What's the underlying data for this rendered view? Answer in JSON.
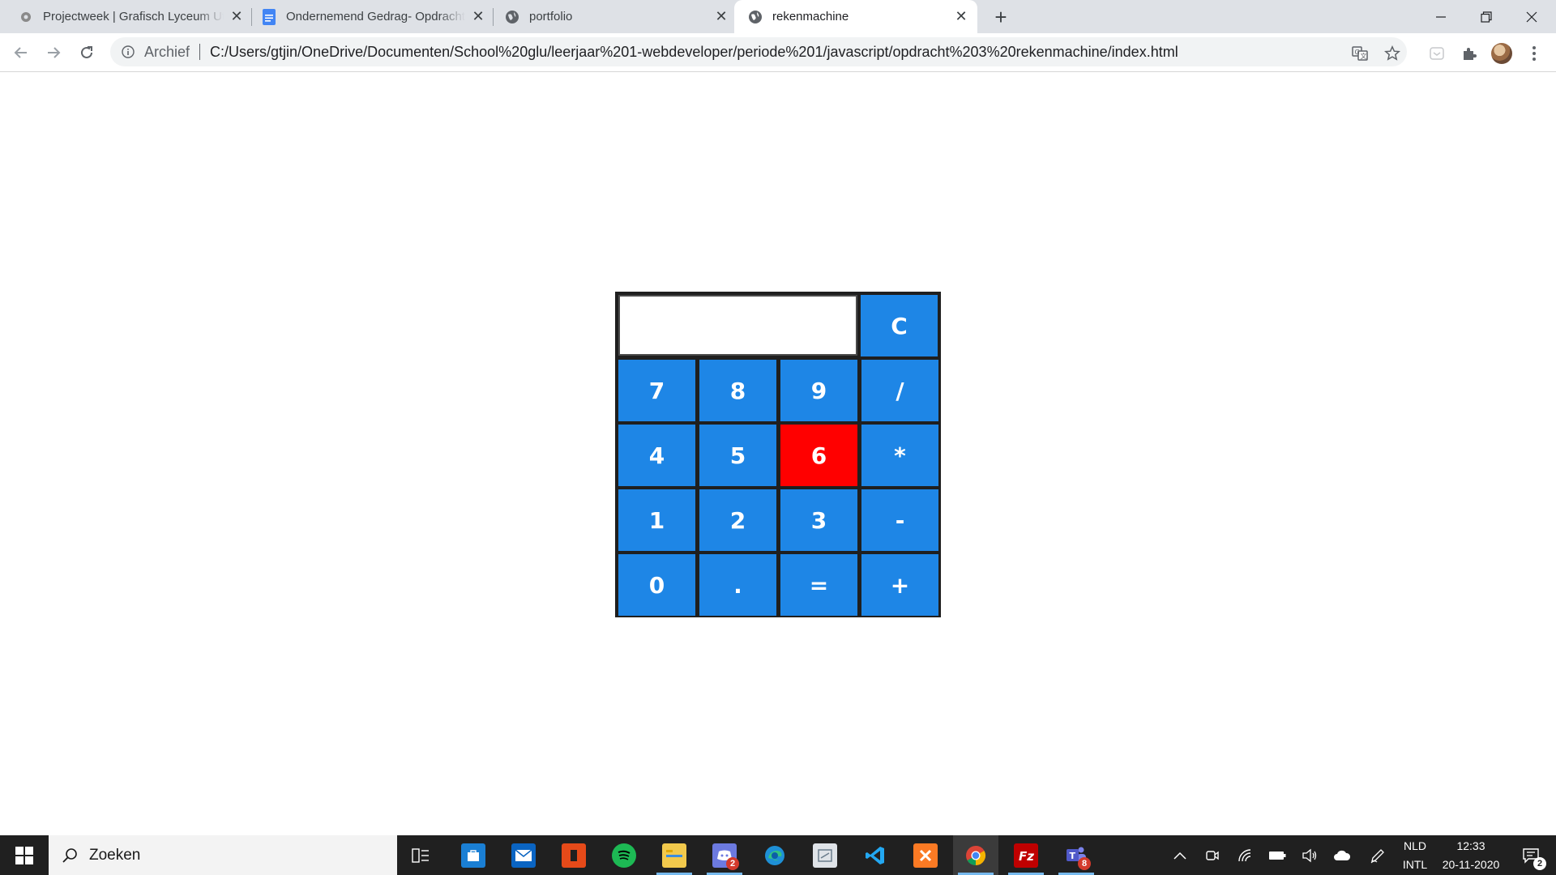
{
  "browser": {
    "tabs": [
      {
        "title": "Projectweek | Grafisch Lyceum Utrecht",
        "icon": "gear-favicon-icon"
      },
      {
        "title": "Ondernemend Gedrag- Opdracht",
        "icon": "google-docs-icon"
      },
      {
        "title": "portfolio",
        "icon": "globe-icon"
      },
      {
        "title": "rekenmachine",
        "icon": "globe-icon",
        "active": true
      }
    ],
    "new_tab_label": "+",
    "window_controls": [
      "minimize",
      "restore",
      "close"
    ]
  },
  "toolbar": {
    "archief_label": "Archief",
    "url": "C:/Users/gtjin/OneDrive/Documenten/School%20glu/leerjaar%201-webdeveloper/periode%201/javascript/opdracht%203%20rekenmachine/index.html"
  },
  "calculator": {
    "display_value": "",
    "clear_label": "C",
    "rows": [
      [
        "7",
        "8",
        "9",
        "/"
      ],
      [
        "4",
        "5",
        "6",
        "*"
      ],
      [
        "1",
        "2",
        "3",
        "-"
      ],
      [
        "0",
        ".",
        "=",
        "+"
      ]
    ],
    "highlighted_key": "6",
    "colors": {
      "button": "#1e86e6",
      "highlight": "#ff0000",
      "border": "#1f1f1f",
      "text": "#ffffff"
    }
  },
  "taskbar": {
    "search_placeholder": "Zoeken",
    "apps": [
      {
        "name": "task-view-icon"
      },
      {
        "name": "store-icon"
      },
      {
        "name": "mail-icon"
      },
      {
        "name": "office-icon"
      },
      {
        "name": "spotify-icon"
      },
      {
        "name": "file-explorer-icon"
      },
      {
        "name": "discord-icon",
        "badge": "2"
      },
      {
        "name": "edge-icon"
      },
      {
        "name": "snipping-tool-icon"
      },
      {
        "name": "vscode-icon"
      },
      {
        "name": "xampp-icon"
      },
      {
        "name": "chrome-icon"
      },
      {
        "name": "filezilla-icon"
      },
      {
        "name": "teams-icon",
        "badge": "8"
      }
    ],
    "language_top": "NLD",
    "language_bottom": "INTL",
    "time": "12:33",
    "date": "20-11-2020",
    "notification_count": "2"
  }
}
